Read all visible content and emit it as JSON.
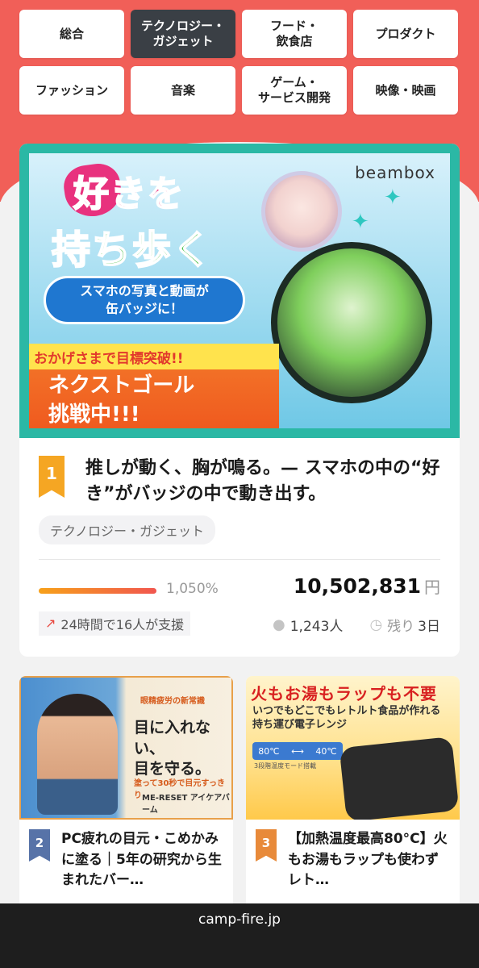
{
  "categories": [
    {
      "label": "総合",
      "active": false
    },
    {
      "label": "テクノロジー・\nガジェット",
      "active": true
    },
    {
      "label": "フード・\n飲食店",
      "active": false
    },
    {
      "label": "プロダクト",
      "active": false
    },
    {
      "label": "ファッション",
      "active": false
    },
    {
      "label": "音楽",
      "active": false
    },
    {
      "label": "ゲーム・\nサービス開発",
      "active": false
    },
    {
      "label": "映像・映画",
      "active": false
    }
  ],
  "featured": {
    "banner": {
      "brand": "beambox",
      "headline_top": "好きを",
      "headline_bottom": "持ち歩く",
      "pill": "スマホの写真と動画が\n缶バッジに！",
      "goal_note": "おかげさまで目標突破!!",
      "next_goal": "ネクストゴール\n挑戦中!!!"
    },
    "rank": "1",
    "title": "推しが動く、胸が鳴る。— スマホの中の“好き”がバッジの中で動き出す。",
    "tag": "テクノロジー・ガジェット",
    "percent": "1,050%",
    "progress_fraction": 1.0,
    "amount": "10,502,831",
    "amount_unit": "円",
    "support_note": "24時間で16人が支援",
    "supporters": "1,243人",
    "remaining_label": "残り",
    "remaining_value": "3日"
  },
  "cards": [
    {
      "rank": "2",
      "title": "PC疲れの目元・こめかみに塗る｜5年の研究から生まれたバー…",
      "img_small": "眼精疲労の新常識",
      "img_big": "目に入れない、\n目を守る。",
      "img_sub": "塗って30秒で目元すっきり",
      "img_product": "ME-RESET アイケアバーム"
    },
    {
      "rank": "3",
      "title": "【加熱温度最高80°C】火もお湯もラップも使わずレト…",
      "img_head": "火もお湯もラップも不要",
      "img_sub": "いつでもどこでもレトルト食品が作れる\n持ち運び電子レンジ",
      "img_temp_low": "80℃",
      "img_temp_high": "40℃",
      "img_mode": "3段階温度モード搭載"
    }
  ],
  "footer": {
    "url": "camp-fire.jp"
  },
  "colors": {
    "header": "#f15f58",
    "rank1": "#f5a623",
    "rank2": "#5773a8",
    "rank3": "#e88a3a",
    "active_tab": "#3a3f45"
  }
}
